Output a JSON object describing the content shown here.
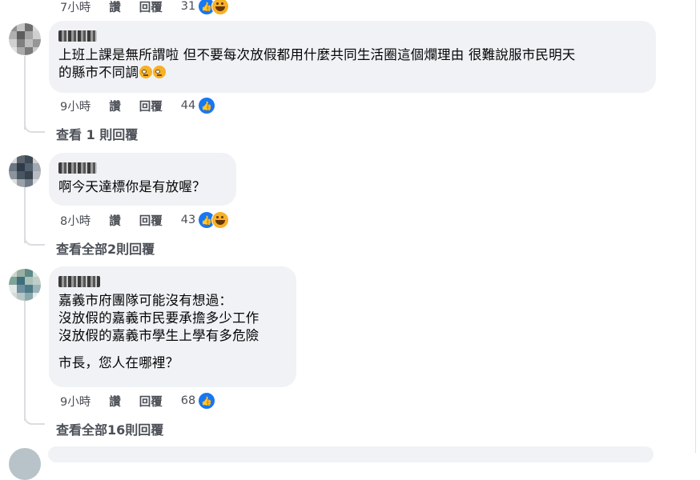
{
  "top_partial": {
    "time": "7小時",
    "like": "讚",
    "reply": "回覆",
    "count": "31"
  },
  "comments": [
    {
      "text": "上班上課是無所謂啦 但不要每次放假都用什麼共同生活圈這個爛理由 很難說服市民明天\n的縣市不同調",
      "time": "9小時",
      "like": "讚",
      "reply": "回覆",
      "count": "44",
      "view_replies": "查看 1 則回覆"
    },
    {
      "text": "啊今天達標你是有放喔？",
      "time": "8小時",
      "like": "讚",
      "reply": "回覆",
      "count": "43",
      "view_replies": "查看全部2則回覆"
    },
    {
      "text": "嘉義市府團隊可能沒有想過：\n沒放假的嘉義市民要承擔多少工作\n沒放假的嘉義市學生上學有多危險",
      "text2": "市長，您人在哪裡？",
      "time": "9小時",
      "like": "讚",
      "reply": "回覆",
      "count": "68",
      "view_replies": "查看全部16則回覆"
    }
  ],
  "colors": {
    "like_blue": "#1877f2",
    "bubble_bg": "#f0f2f5",
    "meta_text": "#4b4f56"
  },
  "icons": [
    "like-icon",
    "haha-icon",
    "roll-eyes-emoji"
  ]
}
